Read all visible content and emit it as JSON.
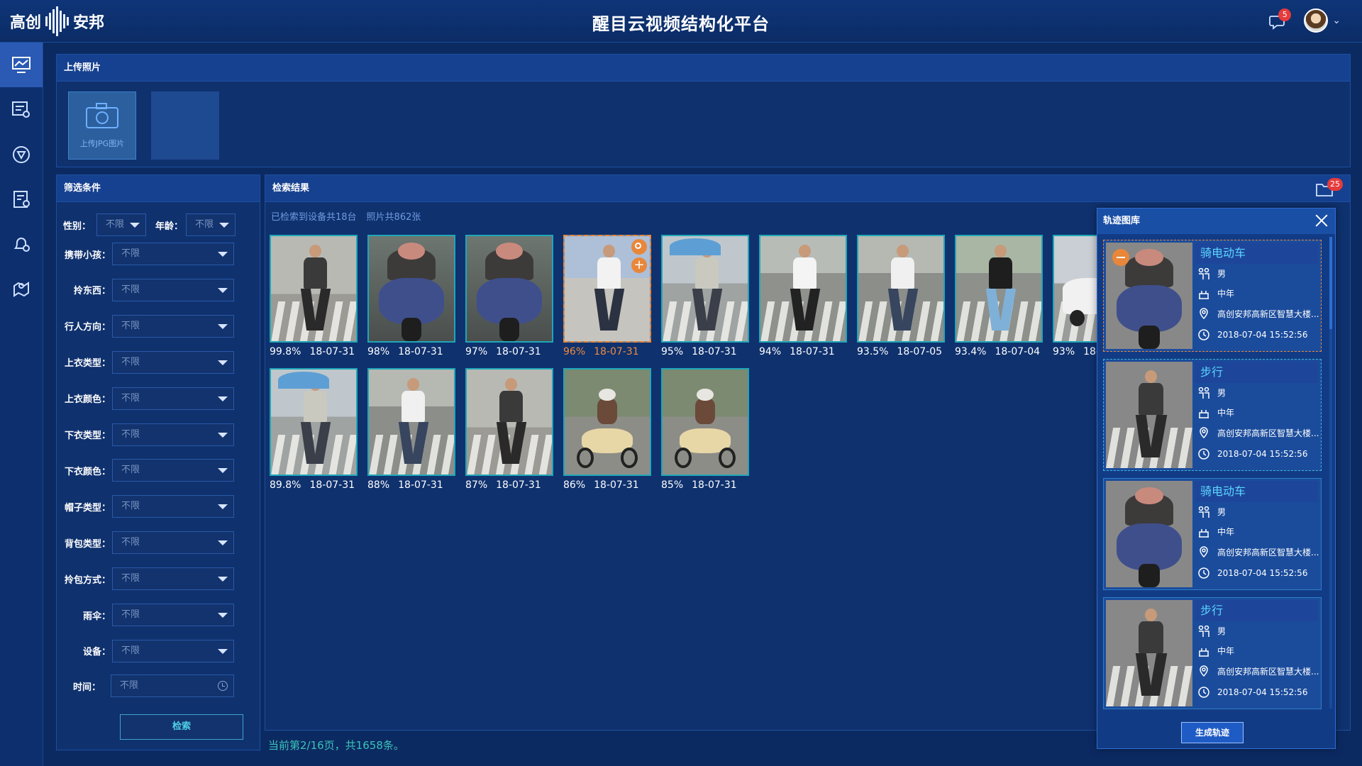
{
  "header": {
    "logo_left": "高创",
    "logo_right": "安邦",
    "title": "醒目云视频结构化平台",
    "notifications": "5"
  },
  "nav": {
    "items": [
      "monitor-icon",
      "device-list-icon",
      "face-icon",
      "record-icon",
      "alarm-icon",
      "map-person-icon"
    ],
    "active": 0
  },
  "upload": {
    "title": "上传照片",
    "button_label": "上传JPG图片"
  },
  "filters": {
    "title": "筛选条件",
    "gender": {
      "label": "性别：",
      "value": "不限"
    },
    "age": {
      "label": "年龄：",
      "value": "不限"
    },
    "rows": [
      {
        "label": "携带小孩：",
        "value": "不限"
      },
      {
        "label": "拎东西：",
        "value": "不限"
      },
      {
        "label": "行人方向：",
        "value": "不限"
      },
      {
        "label": "上衣类型：",
        "value": "不限"
      },
      {
        "label": "上衣颜色：",
        "value": "不限"
      },
      {
        "label": "下衣类型：",
        "value": "不限"
      },
      {
        "label": "下衣颜色：",
        "value": "不限"
      },
      {
        "label": "帽子类型：",
        "value": "不限"
      },
      {
        "label": "背包类型：",
        "value": "不限"
      },
      {
        "label": "拎包方式：",
        "value": "不限"
      },
      {
        "label": "雨伞：",
        "value": "不限"
      },
      {
        "label": "设备：",
        "value": "不限"
      }
    ],
    "time": {
      "label": "时间：",
      "placeholder": "不限"
    },
    "search_label": "检索"
  },
  "results": {
    "title": "检索结果",
    "device_summary": "已检索到设备共18台",
    "photo_summary": "照片共862张",
    "folder_count": "25",
    "items": [
      {
        "score": "99.8%",
        "date": "18-07-31",
        "kind": "woman"
      },
      {
        "score": "98%",
        "date": "18-07-31",
        "kind": "scooter"
      },
      {
        "score": "97%",
        "date": "18-07-31",
        "kind": "scooter"
      },
      {
        "score": "96%",
        "date": "18-07-31",
        "kind": "woman-street",
        "selected": true
      },
      {
        "score": "95%",
        "date": "18-07-31",
        "kind": "umbrella"
      },
      {
        "score": "94%",
        "date": "18-07-31",
        "kind": "man-white"
      },
      {
        "score": "93.5%",
        "date": "18-07-05",
        "kind": "man-bag"
      },
      {
        "score": "93.4%",
        "date": "18-07-04",
        "kind": "man-black"
      },
      {
        "score": "93%",
        "date": "18-",
        "kind": "car"
      },
      {
        "score": "89.8%",
        "date": "18-07-31",
        "kind": "umbrella"
      },
      {
        "score": "88%",
        "date": "18-07-31",
        "kind": "man-bag"
      },
      {
        "score": "87%",
        "date": "18-07-31",
        "kind": "woman"
      },
      {
        "score": "86%",
        "date": "18-07-31",
        "kind": "scooter-rider"
      },
      {
        "score": "85%",
        "date": "18-07-31",
        "kind": "scooter-rider"
      }
    ],
    "pager": "当前第2/16页，共1658条。"
  },
  "track": {
    "title": "轨迹图库",
    "cards": [
      {
        "type": "骑电动车",
        "gender": "男",
        "age": "中年",
        "location": "高创安邦高新区智慧大楼...",
        "time": "2018-07-04  15:52:56",
        "kind": "scooter"
      },
      {
        "type": "步行",
        "gender": "男",
        "age": "中年",
        "location": "高创安邦高新区智慧大楼...",
        "time": "2018-07-04  15:52:56",
        "kind": "woman"
      },
      {
        "type": "骑电动车",
        "gender": "男",
        "age": "中年",
        "location": "高创安邦高新区智慧大楼...",
        "time": "2018-07-04  15:52:56",
        "kind": "scooter"
      },
      {
        "type": "步行",
        "gender": "男",
        "age": "中年",
        "location": "高创安邦高新区智慧大楼...",
        "time": "2018-07-04  15:52:56",
        "kind": "woman"
      }
    ],
    "generate_label": "生成轨迹"
  },
  "colors": {
    "accent": "#1fa7b8",
    "selected": "#e8873a",
    "pager": "#3bc3b8"
  }
}
